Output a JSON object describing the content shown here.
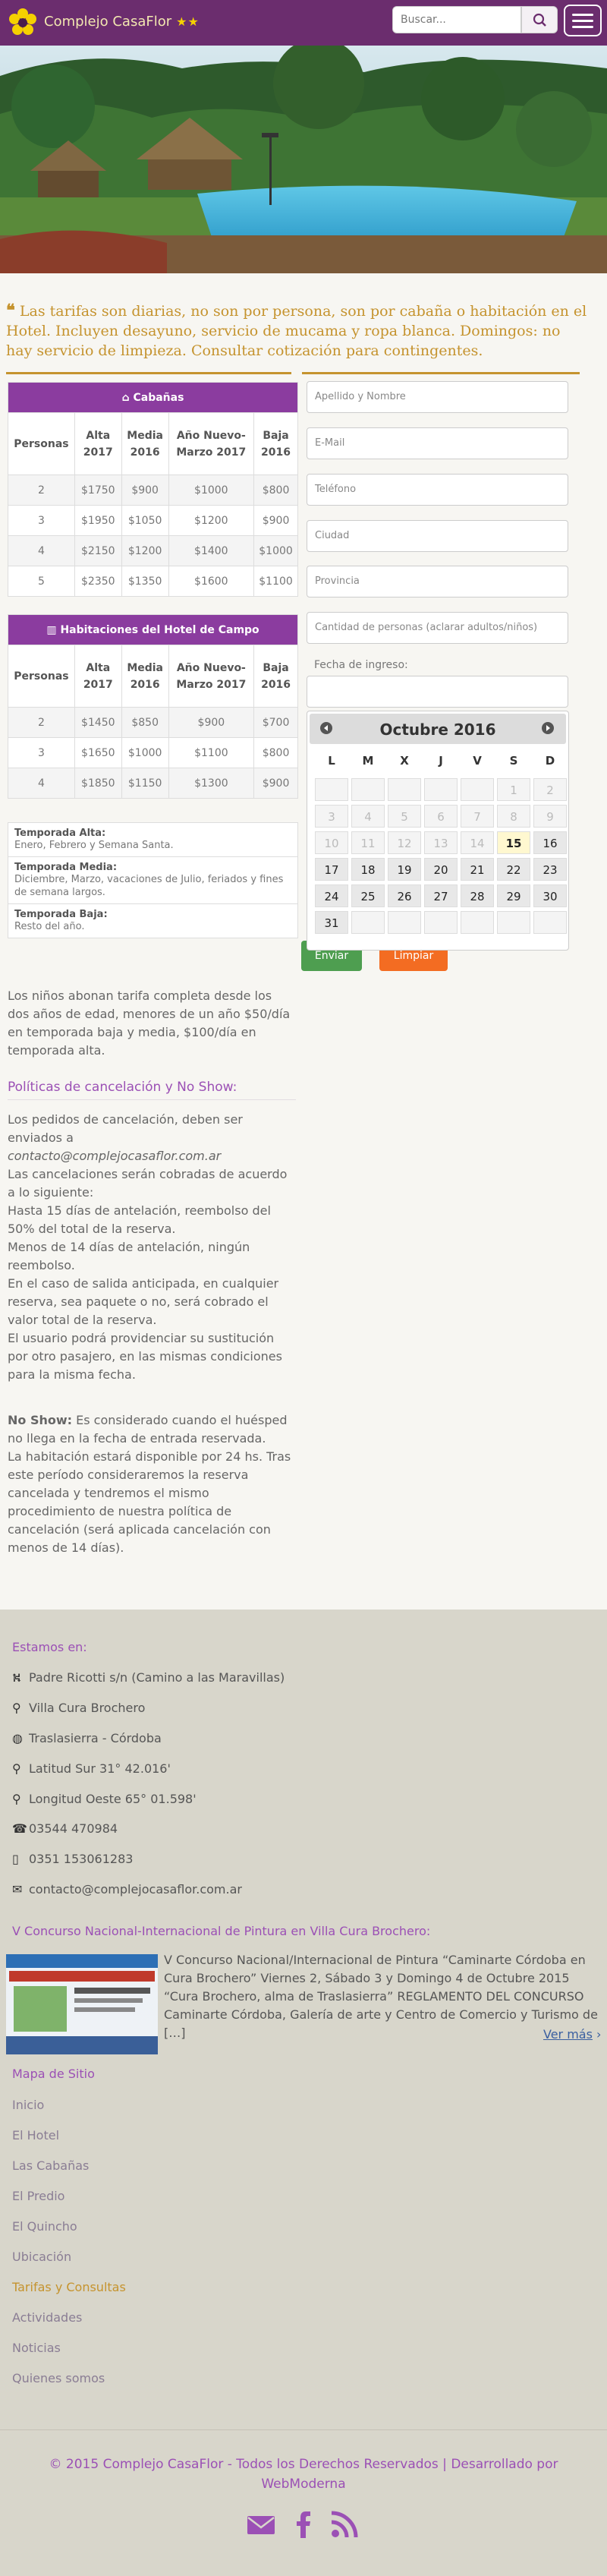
{
  "header": {
    "brand": "Complejo CasaFlor",
    "stars": "★★",
    "search_placeholder": "Buscar..."
  },
  "intro": {
    "quote_mark": "❝",
    "text": "Las tarifas son diarias, no son por persona, son por cabaña o habitación en el Hotel. Incluyen desayuno, servicio de mucama y ropa blanca. Domingos: no hay servicio de limpieza. Consultar cotización para contingentes."
  },
  "cabanas": {
    "title": "Cabañas",
    "columns": [
      "Personas",
      "Alta 2017",
      "Media 2016",
      "Año Nuevo-Marzo 2017",
      "Baja 2016"
    ],
    "rows": [
      [
        "2",
        "$1750",
        "$900",
        "$1000",
        "$800"
      ],
      [
        "3",
        "$1950",
        "$1050",
        "$1200",
        "$900"
      ],
      [
        "4",
        "$2150",
        "$1200",
        "$1400",
        "$1000"
      ],
      [
        "5",
        "$2350",
        "$1350",
        "$1600",
        "$1100"
      ]
    ]
  },
  "hotel": {
    "title": "Habitaciones del Hotel de Campo",
    "columns": [
      "Personas",
      "Alta 2017",
      "Media 2016",
      "Año Nuevo-Marzo 2017",
      "Baja 2016"
    ],
    "rows": [
      [
        "2",
        "$1450",
        "$850",
        "$900",
        "$700"
      ],
      [
        "3",
        "$1650",
        "$1000",
        "$1100",
        "$800"
      ],
      [
        "4",
        "$1850",
        "$1150",
        "$1300",
        "$900"
      ]
    ]
  },
  "seasons": [
    {
      "name": "Temporada Alta:",
      "desc": "Enero, Febrero y Semana Santa."
    },
    {
      "name": "Temporada Media:",
      "desc": "Diciembre, Marzo, vacaciones de Julio, feriados y fines de semana largos."
    },
    {
      "name": "Temporada Baja:",
      "desc": "Resto del año."
    }
  ],
  "form": {
    "nombre": "Apellido y Nombre",
    "email": "E-Mail",
    "telefono": "Teléfono",
    "ciudad": "Ciudad",
    "provincia": "Provincia",
    "personas": "Cantidad de personas (aclarar adultos/niños)",
    "fecha_label": "Fecha de ingreso:",
    "enviar": "Enviar",
    "limpiar": "Limpiar"
  },
  "calendar": {
    "title": "Octubre 2016",
    "weekdays": [
      "L",
      "M",
      "X",
      "J",
      "V",
      "S",
      "D"
    ],
    "selected_day": "15",
    "weeks": [
      [
        "",
        "",
        "",
        "",
        "",
        "1",
        "2"
      ],
      [
        "3",
        "4",
        "5",
        "6",
        "7",
        "8",
        "9"
      ],
      [
        "10",
        "11",
        "12",
        "13",
        "14",
        "15",
        "16"
      ],
      [
        "17",
        "18",
        "19",
        "20",
        "21",
        "22",
        "23"
      ],
      [
        "24",
        "25",
        "26",
        "27",
        "28",
        "29",
        "30"
      ],
      [
        "31",
        "",
        "",
        "",
        "",
        "",
        ""
      ]
    ]
  },
  "ninos": "Los niños abonan tarifa completa desde los dos años de edad, menores de un año $50/día en temporada baja y media, $100/día en temporada alta.",
  "politicas": {
    "title": "Políticas de cancelación y No Show:",
    "p1a": "Los pedidos de cancelación, deben ser enviados a",
    "email": "contacto@complejocasaflor.com.ar",
    "p1b": "Las cancelaciones serán cobradas de acuerdo a lo siguiente:",
    "p1c": "Hasta 15 días de antelación, reembolso del 50% del total de la reserva.",
    "p1d": "Menos de 14 días de antelación, ningún reembolso.",
    "p1e": "En el caso de salida anticipada, en cualquier reserva, sea paquete o no, será cobrado el valor total de la reserva.",
    "p1f": "El usuario podrá providenciar su sustitución por otro pasajero, en las mismas condiciones para la misma fecha.",
    "noshow_label": "No Show:",
    "noshow_text": "Es considerado cuando el huésped no llega en la fecha de entrada reservada.",
    "p2b": "La habitación estará disponible por 24 hs. Tras este período consideraremos la reserva cancelada y tendremos el mismo procedimiento de nuestra política de cancelación (será aplicada cancelación con menos de 14 días)."
  },
  "footer": {
    "estamos_title": "Estamos en:",
    "address": "Padre Ricotti s/n (Camino a las Maravillas)",
    "city": "Villa Cura Brochero",
    "region": "Traslasierra - Córdoba",
    "lat": "Latitud Sur 31° 42.016'",
    "lon": "Longitud Oeste 65° 01.598'",
    "phone1": "03544 470984",
    "phone2": "0351 153061283",
    "email": "contacto@complejocasaflor.com.ar",
    "news_title": "V Concurso Nacional-Internacional de Pintura en Villa Cura Brochero:",
    "news_text": "V Concurso Nacional/Internacional de Pintura “Caminarte Córdoba en Cura Brochero” Viernes 2, Sábado 3 y Domingo 4 de Octubre 2015 “Cura Brochero, alma de Traslasierra” REGLAMENTO DEL CONCURSO Caminarte Córdoba, Galería de arte y Centro de Comercio y Turismo de […]",
    "news_more": "Ver más",
    "sitemap_title": "Mapa de Sitio",
    "sitemap": [
      "Inicio",
      "El Hotel",
      "Las Cabañas",
      "El Predio",
      "El Quincho",
      "Ubicación",
      "Tarifas y Consultas",
      "Actividades",
      "Noticias",
      "Quienes somos"
    ],
    "copyright": "© 2015 Complejo CasaFlor - Todos los Derechos Reservados | Desarrollado por WebModerna"
  }
}
